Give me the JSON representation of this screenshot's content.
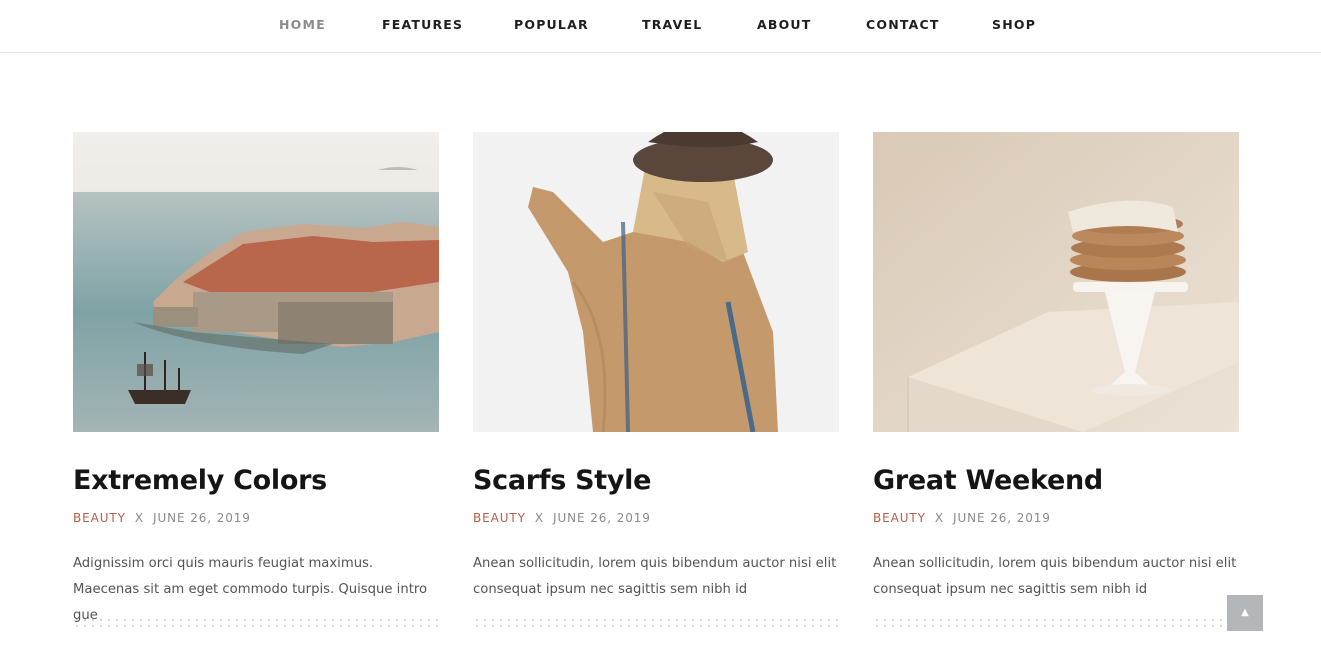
{
  "nav": {
    "items": [
      {
        "label": "HOME",
        "active": true
      },
      {
        "label": "FEATURES"
      },
      {
        "label": "POPULAR"
      },
      {
        "label": "TRAVEL"
      },
      {
        "label": "ABOUT"
      },
      {
        "label": "CONTACT"
      },
      {
        "label": "SHOP"
      }
    ]
  },
  "posts": [
    {
      "title": "Extremely Colors",
      "category": "BEAUTY",
      "separator": "X",
      "date": "JUNE 26, 2019",
      "excerpt": "Adignissim orci quis mauris feugiat maximus. Maecenas sit am eget commodo turpis. Quisque intro gue"
    },
    {
      "title": "Scarfs Style",
      "category": "BEAUTY",
      "separator": "X",
      "date": "JUNE 26, 2019",
      "excerpt": "Anean sollicitudin, lorem quis bibendum auctor nisi elit consequat ipsum nec sagittis sem nibh id"
    },
    {
      "title": "Great Weekend",
      "category": "BEAUTY",
      "separator": "X",
      "date": "JUNE 26, 2019",
      "excerpt": "Anean sollicitudin, lorem quis bibendum auctor nisi elit consequat ipsum nec sagittis sem nibh id"
    }
  ],
  "back_to_top": {
    "icon": "chevron-up-icon",
    "glyph": "▲"
  },
  "colors": {
    "accent": "#b5614a",
    "nav_active": "#8c8c8c",
    "back_to_top_bg": "#b4b7ba"
  }
}
